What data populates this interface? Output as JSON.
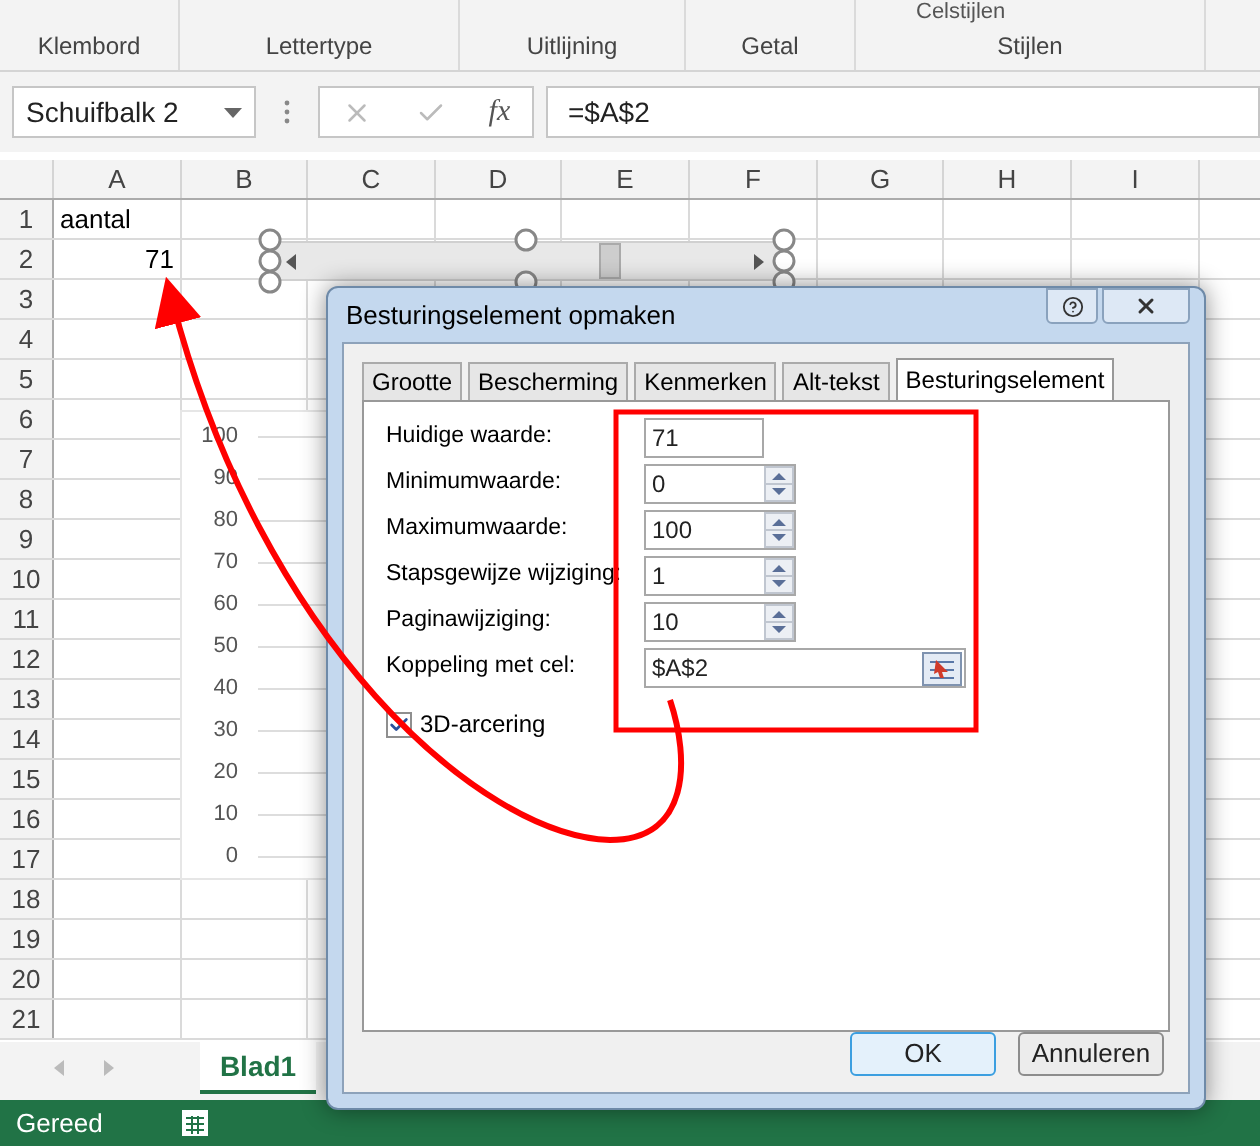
{
  "ribbon": {
    "top_cut": "Celstijlen",
    "groups": [
      "Klembord",
      "Lettertype",
      "Uitlijning",
      "Getal",
      "Stijlen"
    ]
  },
  "formula_bar": {
    "name_box": "Schuifbalk 2",
    "function_label": "fx",
    "formula": "=$A$2"
  },
  "sheet": {
    "columns": [
      "A",
      "B",
      "C",
      "D",
      "E",
      "F",
      "G",
      "H",
      "I"
    ],
    "rows": [
      {
        "header": "1",
        "a": "aantal",
        "kind": "text"
      },
      {
        "header": "2",
        "a": "71",
        "kind": "number"
      },
      {
        "header": "3"
      },
      {
        "header": "4"
      },
      {
        "header": "5"
      },
      {
        "header": "6"
      },
      {
        "header": "7"
      },
      {
        "header": "8"
      },
      {
        "header": "9"
      },
      {
        "header": "10"
      },
      {
        "header": "11"
      },
      {
        "header": "12"
      },
      {
        "header": "13"
      },
      {
        "header": "14"
      },
      {
        "header": "15"
      },
      {
        "header": "16"
      },
      {
        "header": "17"
      },
      {
        "header": "18"
      },
      {
        "header": "19"
      },
      {
        "header": "20"
      },
      {
        "header": "21"
      }
    ]
  },
  "scale_labels": [
    "100",
    "90",
    "80",
    "70",
    "60",
    "50",
    "40",
    "30",
    "20",
    "10",
    "0"
  ],
  "sheet_tabs": [
    {
      "label": "Blad1",
      "selected": true
    }
  ],
  "status_bar": {
    "text": "Gereed"
  },
  "dialog": {
    "title": "Besturingselement opmaken",
    "tabs": [
      {
        "label": "Grootte",
        "selected": false
      },
      {
        "label": "Bescherming",
        "selected": false
      },
      {
        "label": "Kenmerken",
        "selected": false
      },
      {
        "label": "Alt-tekst",
        "selected": false
      },
      {
        "label": "Besturingselement",
        "selected": true
      }
    ],
    "fields": [
      {
        "label": "Huidige waarde:",
        "value": "71",
        "kind": "plain"
      },
      {
        "label": "Minimumwaarde:",
        "value": "0",
        "kind": "spin"
      },
      {
        "label": "Maximumwaarde:",
        "value": "100",
        "kind": "spin"
      },
      {
        "label": "Stapsgewijze wijziging:",
        "value": "1",
        "kind": "spin"
      },
      {
        "label": "Paginawijziging:",
        "value": "10",
        "kind": "spin"
      },
      {
        "label": "Koppeling met cel:",
        "value": "$A$2",
        "kind": "ref"
      }
    ],
    "checkbox": {
      "label": "3D-arcering",
      "checked": true
    },
    "buttons": [
      {
        "label": "OK",
        "kind": "default"
      },
      {
        "label": "Annuleren",
        "kind": "normal"
      }
    ]
  }
}
